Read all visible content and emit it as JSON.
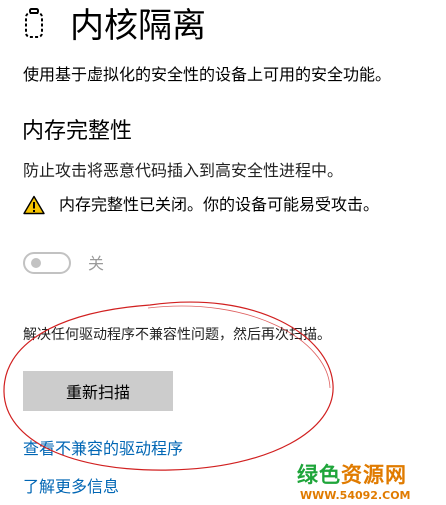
{
  "header": {
    "icon": "core-isolation-icon",
    "title": "内核隔离",
    "description": "使用基于虚拟化的安全性的设备上可用的安全功能。"
  },
  "memory_integrity": {
    "title": "内存完整性",
    "description": "防止攻击将恶意代码插入到高安全性进程中。",
    "warning_icon": "warning-icon",
    "warning_text": "内存完整性已关闭。你的设备可能易受攻击。",
    "toggle": {
      "state": "off",
      "label": "关"
    },
    "hint": "解决任何驱动程序不兼容性问题，然后再次扫描。",
    "rescan_label": "重新扫描"
  },
  "links": {
    "view_incompatible": "查看不兼容的驱动程序",
    "learn_more": "了解更多信息"
  },
  "watermark": {
    "name": "绿色资源网",
    "url": "WWW.54092.COM"
  },
  "colors": {
    "link": "#0066b4",
    "button_bg": "#cccccc",
    "warning_yellow": "#f7c400",
    "annotation_red": "#d12020",
    "watermark_green": "#1ea53a",
    "watermark_orange": "#e07b00"
  }
}
